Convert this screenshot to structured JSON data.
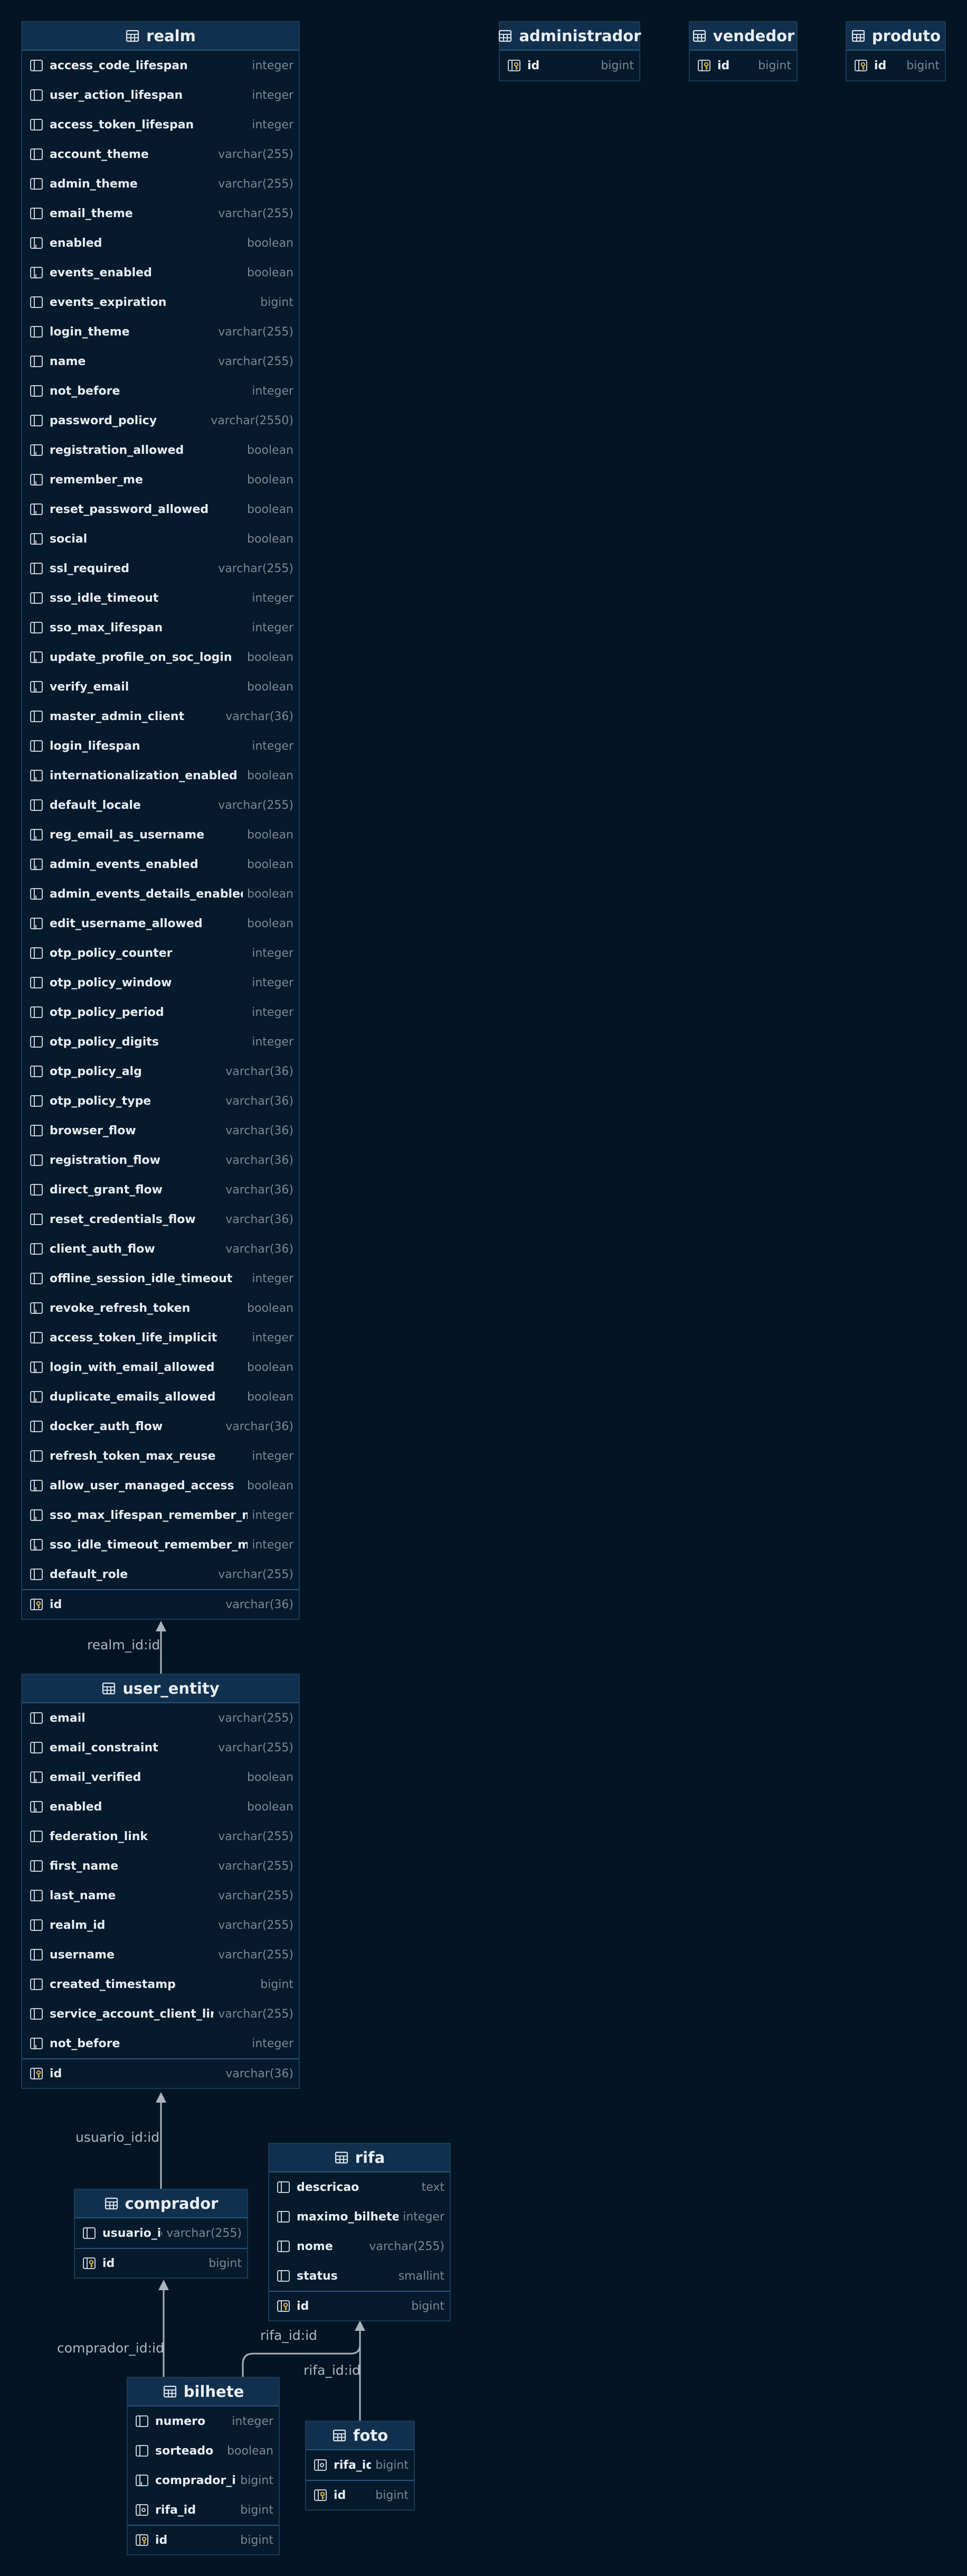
{
  "tables": [
    {
      "key": "realm",
      "name": "realm",
      "columns": [
        {
          "name": "access_code_lifespan",
          "type": "integer",
          "icon": "column-icon"
        },
        {
          "name": "user_action_lifespan",
          "type": "integer",
          "icon": "column-icon"
        },
        {
          "name": "access_token_lifespan",
          "type": "integer",
          "icon": "column-icon"
        },
        {
          "name": "account_theme",
          "type": "varchar(255)",
          "icon": "column-icon"
        },
        {
          "name": "admin_theme",
          "type": "varchar(255)",
          "icon": "column-icon"
        },
        {
          "name": "email_theme",
          "type": "varchar(255)",
          "icon": "column-icon"
        },
        {
          "name": "enabled",
          "type": "boolean",
          "icon": "not-null-column-icon"
        },
        {
          "name": "events_enabled",
          "type": "boolean",
          "icon": "not-null-column-icon"
        },
        {
          "name": "events_expiration",
          "type": "bigint",
          "icon": "column-icon"
        },
        {
          "name": "login_theme",
          "type": "varchar(255)",
          "icon": "column-icon"
        },
        {
          "name": "name",
          "type": "varchar(255)",
          "icon": "column-icon"
        },
        {
          "name": "not_before",
          "type": "integer",
          "icon": "column-icon"
        },
        {
          "name": "password_policy",
          "type": "varchar(2550)",
          "icon": "column-icon"
        },
        {
          "name": "registration_allowed",
          "type": "boolean",
          "icon": "not-null-column-icon"
        },
        {
          "name": "remember_me",
          "type": "boolean",
          "icon": "not-null-column-icon"
        },
        {
          "name": "reset_password_allowed",
          "type": "boolean",
          "icon": "not-null-column-icon"
        },
        {
          "name": "social",
          "type": "boolean",
          "icon": "not-null-column-icon"
        },
        {
          "name": "ssl_required",
          "type": "varchar(255)",
          "icon": "column-icon"
        },
        {
          "name": "sso_idle_timeout",
          "type": "integer",
          "icon": "column-icon"
        },
        {
          "name": "sso_max_lifespan",
          "type": "integer",
          "icon": "column-icon"
        },
        {
          "name": "update_profile_on_soc_login",
          "type": "boolean",
          "icon": "not-null-column-icon"
        },
        {
          "name": "verify_email",
          "type": "boolean",
          "icon": "not-null-column-icon"
        },
        {
          "name": "master_admin_client",
          "type": "varchar(36)",
          "icon": "column-icon"
        },
        {
          "name": "login_lifespan",
          "type": "integer",
          "icon": "column-icon"
        },
        {
          "name": "internationalization_enabled",
          "type": "boolean",
          "icon": "not-null-column-icon"
        },
        {
          "name": "default_locale",
          "type": "varchar(255)",
          "icon": "column-icon"
        },
        {
          "name": "reg_email_as_username",
          "type": "boolean",
          "icon": "not-null-column-icon"
        },
        {
          "name": "admin_events_enabled",
          "type": "boolean",
          "icon": "not-null-column-icon"
        },
        {
          "name": "admin_events_details_enabled",
          "type": "boolean",
          "icon": "not-null-column-icon"
        },
        {
          "name": "edit_username_allowed",
          "type": "boolean",
          "icon": "not-null-column-icon"
        },
        {
          "name": "otp_policy_counter",
          "type": "integer",
          "icon": "column-icon"
        },
        {
          "name": "otp_policy_window",
          "type": "integer",
          "icon": "column-icon"
        },
        {
          "name": "otp_policy_period",
          "type": "integer",
          "icon": "column-icon"
        },
        {
          "name": "otp_policy_digits",
          "type": "integer",
          "icon": "column-icon"
        },
        {
          "name": "otp_policy_alg",
          "type": "varchar(36)",
          "icon": "column-icon"
        },
        {
          "name": "otp_policy_type",
          "type": "varchar(36)",
          "icon": "column-icon"
        },
        {
          "name": "browser_flow",
          "type": "varchar(36)",
          "icon": "column-icon"
        },
        {
          "name": "registration_flow",
          "type": "varchar(36)",
          "icon": "column-icon"
        },
        {
          "name": "direct_grant_flow",
          "type": "varchar(36)",
          "icon": "column-icon"
        },
        {
          "name": "reset_credentials_flow",
          "type": "varchar(36)",
          "icon": "column-icon"
        },
        {
          "name": "client_auth_flow",
          "type": "varchar(36)",
          "icon": "column-icon"
        },
        {
          "name": "offline_session_idle_timeout",
          "type": "integer",
          "icon": "column-icon"
        },
        {
          "name": "revoke_refresh_token",
          "type": "boolean",
          "icon": "not-null-column-icon"
        },
        {
          "name": "access_token_life_implicit",
          "type": "integer",
          "icon": "column-icon"
        },
        {
          "name": "login_with_email_allowed",
          "type": "boolean",
          "icon": "not-null-column-icon"
        },
        {
          "name": "duplicate_emails_allowed",
          "type": "boolean",
          "icon": "not-null-column-icon"
        },
        {
          "name": "docker_auth_flow",
          "type": "varchar(36)",
          "icon": "column-icon"
        },
        {
          "name": "refresh_token_max_reuse",
          "type": "integer",
          "icon": "column-icon"
        },
        {
          "name": "allow_user_managed_access",
          "type": "boolean",
          "icon": "not-null-column-icon"
        },
        {
          "name": "sso_max_lifespan_remember_me",
          "type": "integer",
          "icon": "not-null-column-icon"
        },
        {
          "name": "sso_idle_timeout_remember_me",
          "type": "integer",
          "icon": "not-null-column-icon"
        },
        {
          "name": "default_role",
          "type": "varchar(255)",
          "icon": "column-icon"
        }
      ],
      "pk": {
        "name": "id",
        "type": "varchar(36)",
        "icon": "primary-key-icon"
      }
    },
    {
      "key": "administrador",
      "name": "administrador",
      "columns": [],
      "pk": {
        "name": "id",
        "type": "bigint",
        "icon": "primary-key-icon"
      }
    },
    {
      "key": "vendedor",
      "name": "vendedor",
      "columns": [],
      "pk": {
        "name": "id",
        "type": "bigint",
        "icon": "primary-key-icon"
      }
    },
    {
      "key": "produto",
      "name": "produto",
      "columns": [],
      "pk": {
        "name": "id",
        "type": "bigint",
        "icon": "primary-key-icon"
      }
    },
    {
      "key": "user_entity",
      "name": "user_entity",
      "columns": [
        {
          "name": "email",
          "type": "varchar(255)",
          "icon": "column-icon"
        },
        {
          "name": "email_constraint",
          "type": "varchar(255)",
          "icon": "column-icon"
        },
        {
          "name": "email_verified",
          "type": "boolean",
          "icon": "not-null-column-icon"
        },
        {
          "name": "enabled",
          "type": "boolean",
          "icon": "not-null-column-icon"
        },
        {
          "name": "federation_link",
          "type": "varchar(255)",
          "icon": "column-icon"
        },
        {
          "name": "first_name",
          "type": "varchar(255)",
          "icon": "column-icon"
        },
        {
          "name": "last_name",
          "type": "varchar(255)",
          "icon": "column-icon"
        },
        {
          "name": "realm_id",
          "type": "varchar(255)",
          "icon": "column-icon"
        },
        {
          "name": "username",
          "type": "varchar(255)",
          "icon": "column-icon"
        },
        {
          "name": "created_timestamp",
          "type": "bigint",
          "icon": "column-icon"
        },
        {
          "name": "service_account_client_link",
          "type": "varchar(255)",
          "icon": "column-icon"
        },
        {
          "name": "not_before",
          "type": "integer",
          "icon": "not-null-column-icon"
        }
      ],
      "pk": {
        "name": "id",
        "type": "varchar(36)",
        "icon": "primary-key-icon"
      }
    },
    {
      "key": "rifa",
      "name": "rifa",
      "columns": [
        {
          "name": "descricao",
          "type": "text",
          "icon": "column-icon"
        },
        {
          "name": "maximo_bilhetes",
          "type": "integer",
          "icon": "column-icon"
        },
        {
          "name": "nome",
          "type": "varchar(255)",
          "icon": "column-icon"
        },
        {
          "name": "status",
          "type": "smallint",
          "icon": "column-icon"
        }
      ],
      "pk": {
        "name": "id",
        "type": "bigint",
        "icon": "primary-key-icon"
      }
    },
    {
      "key": "comprador",
      "name": "comprador",
      "columns": [
        {
          "name": "usuario_id",
          "type": "varchar(255)",
          "icon": "column-icon"
        }
      ],
      "pk": {
        "name": "id",
        "type": "bigint",
        "icon": "primary-key-icon"
      }
    },
    {
      "key": "bilhete",
      "name": "bilhete",
      "columns": [
        {
          "name": "numero",
          "type": "integer",
          "icon": "column-icon"
        },
        {
          "name": "sorteado",
          "type": "boolean",
          "icon": "column-icon"
        },
        {
          "name": "comprador_id",
          "type": "bigint",
          "icon": "not-null-column-icon"
        },
        {
          "name": "rifa_id",
          "type": "bigint",
          "icon": "foreign-key-icon"
        }
      ],
      "pk": {
        "name": "id",
        "type": "bigint",
        "icon": "primary-key-icon"
      }
    },
    {
      "key": "foto",
      "name": "foto",
      "columns": [
        {
          "name": "rifa_id",
          "type": "bigint",
          "icon": "foreign-key-icon"
        }
      ],
      "pk": {
        "name": "id",
        "type": "bigint",
        "icon": "primary-key-icon"
      }
    }
  ],
  "relations": [
    {
      "key": "rel-realm",
      "label": "realm_id:id"
    },
    {
      "key": "rel-usuario",
      "label": "usuario_id:id"
    },
    {
      "key": "rel-comprador",
      "label": "comprador_id:id"
    },
    {
      "key": "rel-rifa-bilhete",
      "label": "rifa_id:id"
    },
    {
      "key": "rel-rifa-foto",
      "label": "rifa_id:id"
    }
  ]
}
